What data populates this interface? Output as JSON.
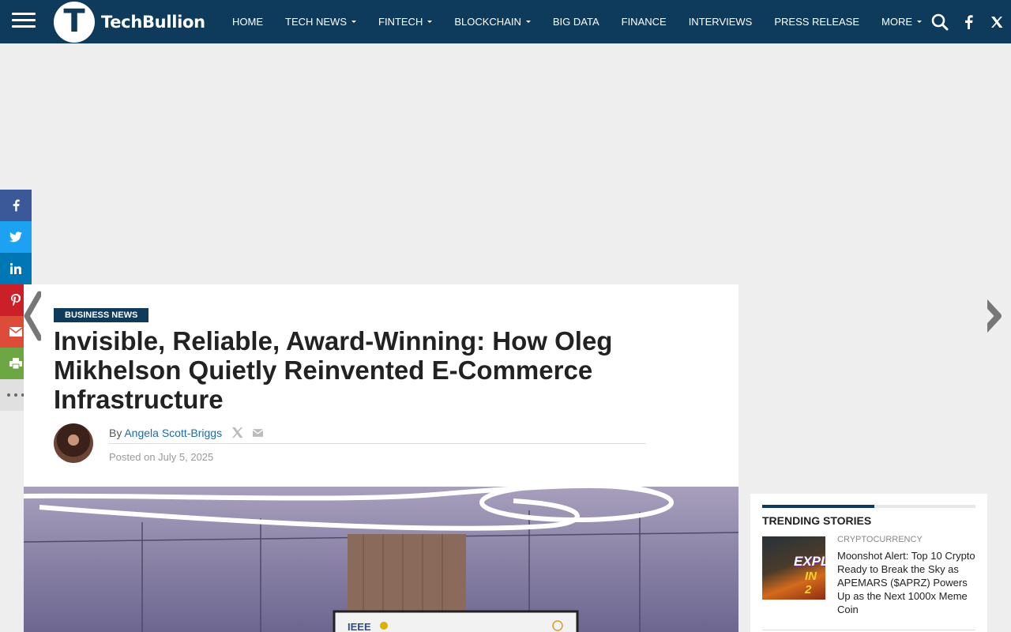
{
  "header": {
    "logo_letter": "T",
    "logo_text": "TechBullion",
    "nav": [
      {
        "label": "HOME"
      },
      {
        "label": "TECH NEWS"
      },
      {
        "label": "FINTECH"
      },
      {
        "label": "BLOCKCHAIN"
      },
      {
        "label": "BIG DATA"
      },
      {
        "label": "FINANCE"
      },
      {
        "label": "INTERVIEWS"
      },
      {
        "label": "PRESS RELEASE"
      },
      {
        "label": "MORE"
      }
    ],
    "brand_color": "#0e3a5c"
  },
  "share_bar": {
    "colors": {
      "facebook": "#3b5998",
      "twitter": "#1da1f2",
      "linkedin": "#0077b5",
      "pinterest": "#cb2027",
      "email": "#dd4b39",
      "print": "#6ca744",
      "more": "#e0e0e0"
    }
  },
  "article": {
    "category": "BUSINESS NEWS",
    "title": "Invisible, Reliable, Award-Winning: How Oleg Mikhelson Quietly Reinvented E-Commerce Infrastructure",
    "by_prefix": "By",
    "author": "Angela Scott-Briggs",
    "posted": "Posted on July 5, 2025",
    "hero_sign_text": "IEEE"
  },
  "sidebar": {
    "trending_title": "TRENDING STORIES",
    "items": [
      {
        "category": "CRYPTOCURRENCY",
        "headline": "Moonshot Alert: Top 10 Crypto Ready to Break the Sky as APEMARS ($APRZ) Powers Up as the Next 1000x Meme Coin",
        "thumb_text_1": "EXPL",
        "thumb_text_2": "IN 2"
      }
    ]
  }
}
